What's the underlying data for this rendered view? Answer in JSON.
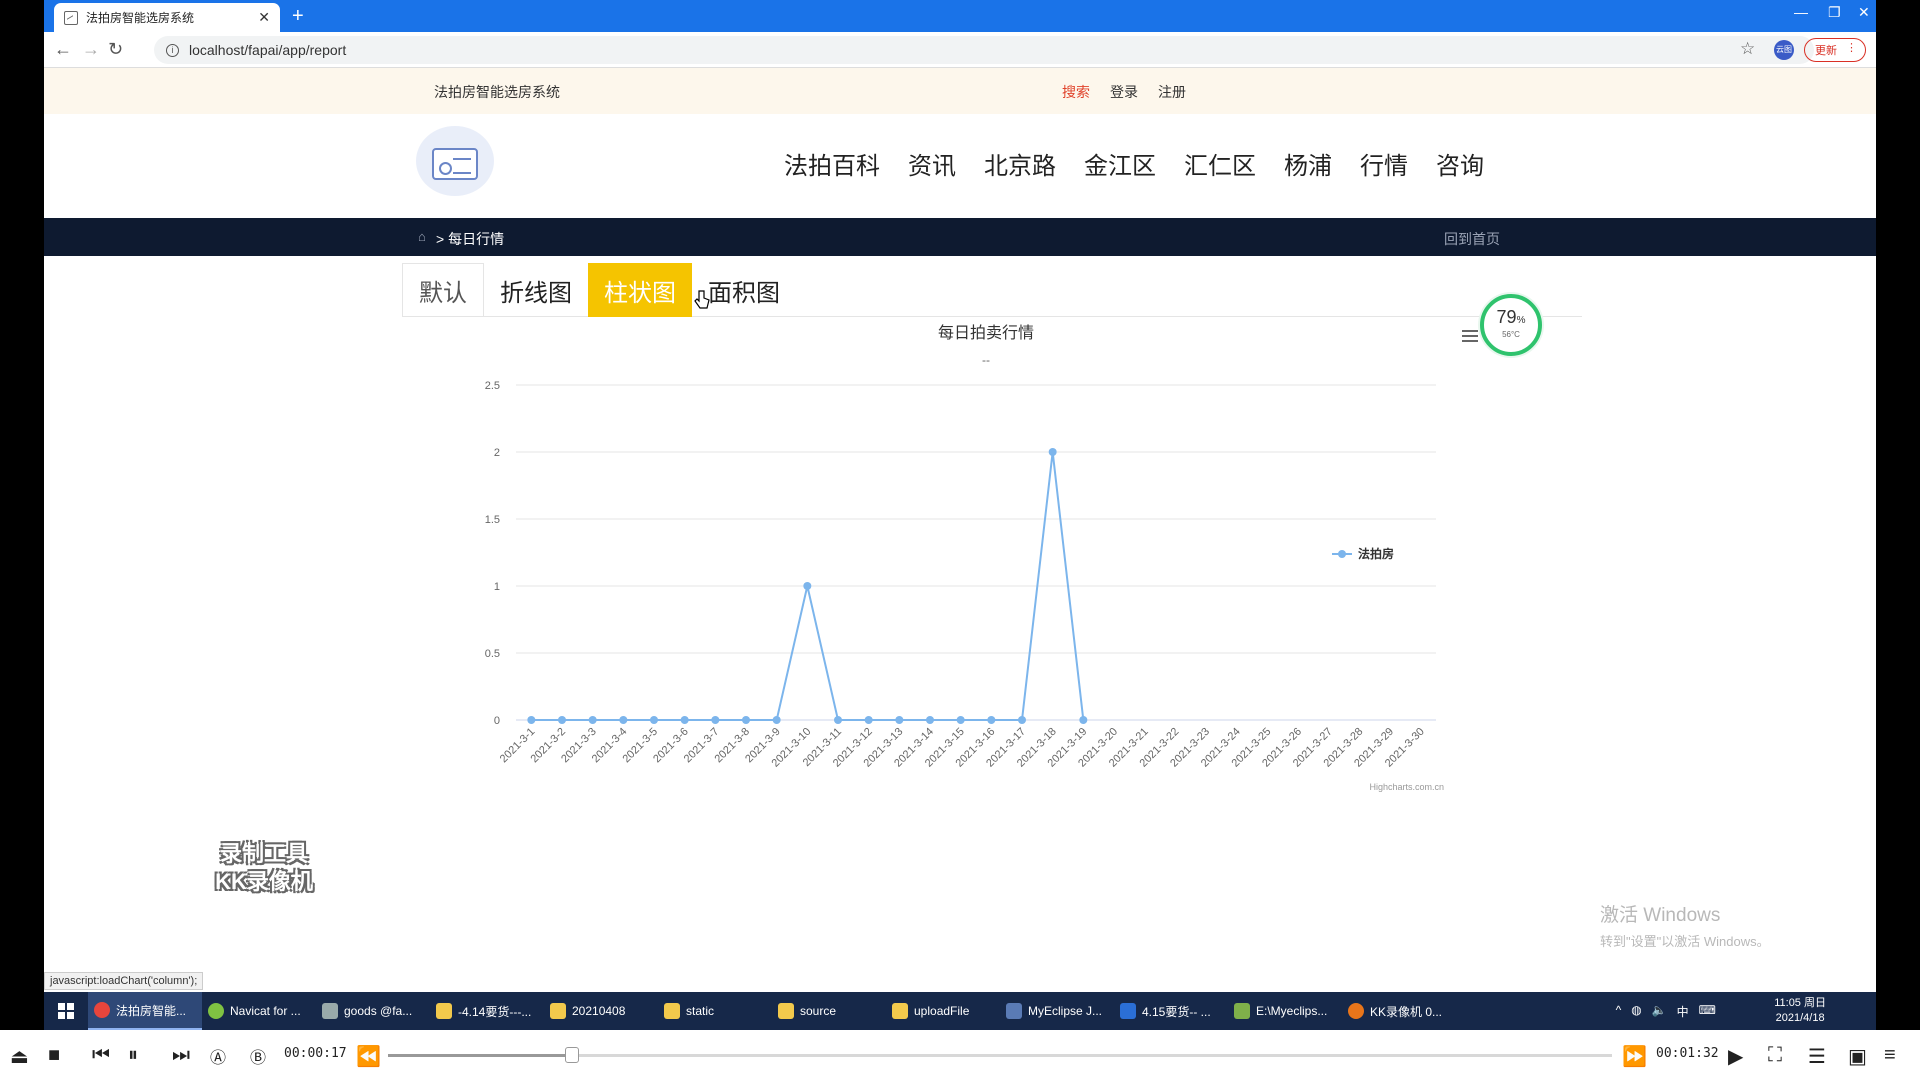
{
  "browser": {
    "tab_title": "法拍房智能选房系统",
    "url": "localhost/fapai/app/report",
    "update_label": "更新",
    "profile_label": "云图"
  },
  "site": {
    "name": "法拍房智能选房系统",
    "top_links": [
      "搜索",
      "登录",
      "注册"
    ],
    "nav": [
      "法拍百科",
      "资讯",
      "北京路",
      "金江区",
      "汇仁区",
      "杨浦",
      "行情",
      "咨询"
    ],
    "breadcrumb": "> 每日行情",
    "back_home": "回到首页"
  },
  "chart_tabs": [
    "默认",
    "折线图",
    "柱状图",
    "面积图"
  ],
  "gauge": {
    "percent": "79",
    "unit": "%",
    "temp": "56°C"
  },
  "chart_data": {
    "type": "line",
    "title": "每日拍卖行情",
    "subtitle": "--",
    "categories": [
      "2021-3-1",
      "2021-3-2",
      "2021-3-3",
      "2021-3-4",
      "2021-3-5",
      "2021-3-6",
      "2021-3-7",
      "2021-3-8",
      "2021-3-9",
      "2021-3-10",
      "2021-3-11",
      "2021-3-12",
      "2021-3-13",
      "2021-3-14",
      "2021-3-15",
      "2021-3-16",
      "2021-3-17",
      "2021-3-18",
      "2021-3-19",
      "2021-3-20",
      "2021-3-21",
      "2021-3-22",
      "2021-3-23",
      "2021-3-24",
      "2021-3-25",
      "2021-3-26",
      "2021-3-27",
      "2021-3-28",
      "2021-3-29",
      "2021-3-30"
    ],
    "series": [
      {
        "name": "法拍房",
        "values": [
          0,
          0,
          0,
          0,
          0,
          0,
          0,
          0,
          0,
          1,
          0,
          0,
          0,
          0,
          0,
          0,
          0,
          2,
          0
        ]
      }
    ],
    "yticks": [
      "0",
      "0.5",
      "1",
      "1.5",
      "2",
      "2.5"
    ],
    "ylim": [
      0,
      2.5
    ],
    "credits": "Highcharts.com.cn",
    "legend_position": "right",
    "color": "#7cb5ec",
    "grid": true
  },
  "overlay": {
    "kk_line1": "录制工具",
    "kk_line2": "KK录像机",
    "activate_title": "激活 Windows",
    "activate_sub": "转到\"设置\"以激活 Windows。",
    "status_url": "javascript:loadChart('column');"
  },
  "taskbar": {
    "items": [
      "法拍房智能...",
      "Navicat for ...",
      "goods @fa...",
      "-4.14要货---...",
      "20210408",
      "static",
      "source",
      "uploadFile",
      "MyEclipse J...",
      "4.15要货-- ...",
      "E:\\Myeclips...",
      "KK录像机 0..."
    ],
    "tray_ime": "中",
    "time": "11:05 周日",
    "date": "2021/4/18"
  },
  "player": {
    "elapsed": "00:00:17",
    "total": "00:01:32",
    "progress": 0.15
  }
}
